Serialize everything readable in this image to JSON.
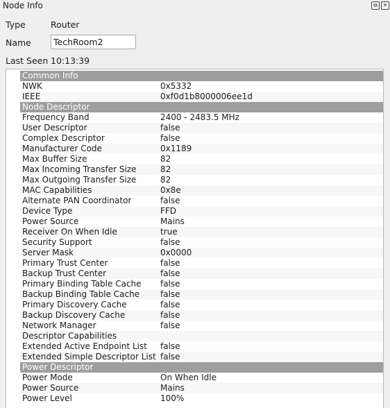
{
  "window": {
    "title": "Node Info"
  },
  "fields": {
    "type_label": "Type",
    "type_value": "Router",
    "name_label": "Name",
    "name_value": "TechRoom2",
    "last_seen_label": "Last Seen",
    "last_seen_value": "10:13:39"
  },
  "tree": {
    "rows": [
      {
        "section": true,
        "label": "Common Info"
      },
      {
        "label": "NWK",
        "value": "0x5332"
      },
      {
        "label": "IEEE",
        "value": "0xf0d1b8000006ee1d"
      },
      {
        "section": true,
        "label": "Node Descriptor"
      },
      {
        "label": "Frequency Band",
        "value": "2400 - 2483.5 MHz"
      },
      {
        "label": "User Descriptor",
        "value": "false"
      },
      {
        "label": "Complex Descriptor",
        "value": "false"
      },
      {
        "label": "Manufacturer Code",
        "value": "0x1189"
      },
      {
        "label": "Max Buffer Size",
        "value": "82"
      },
      {
        "label": "Max Incoming Transfer Size",
        "value": "82"
      },
      {
        "label": "Max Outgoing Transfer Size",
        "value": "82"
      },
      {
        "label": "MAC Capabilities",
        "value": "0x8e"
      },
      {
        "label": "Alternate PAN Coordinator",
        "value": "false"
      },
      {
        "label": "Device Type",
        "value": "FFD"
      },
      {
        "label": "Power Source",
        "value": "Mains"
      },
      {
        "label": "Receiver On When Idle",
        "value": "true"
      },
      {
        "label": "Security Support",
        "value": "false"
      },
      {
        "label": "Server Mask",
        "value": "0x0000"
      },
      {
        "label": "Primary Trust Center",
        "value": "false"
      },
      {
        "label": "Backup Trust Center",
        "value": "false"
      },
      {
        "label": "Primary Binding Table Cache",
        "value": "false"
      },
      {
        "label": "Backup Binding Table Cache",
        "value": "false"
      },
      {
        "label": "Primary Discovery Cache",
        "value": "false"
      },
      {
        "label": "Backup Discovery Cache",
        "value": "false"
      },
      {
        "label": "Network Manager",
        "value": "false"
      },
      {
        "label": "Descriptor Capabilities",
        "value": ""
      },
      {
        "label": "Extended Active Endpoint List",
        "value": "false"
      },
      {
        "label": "Extended Simple Descriptor List",
        "value": "false"
      },
      {
        "section": true,
        "label": "Power Descriptor"
      },
      {
        "label": "Power Mode",
        "value": "On When Idle"
      },
      {
        "label": "Power Source",
        "value": "Mains"
      },
      {
        "label": "Power Level",
        "value": "100%"
      }
    ]
  }
}
